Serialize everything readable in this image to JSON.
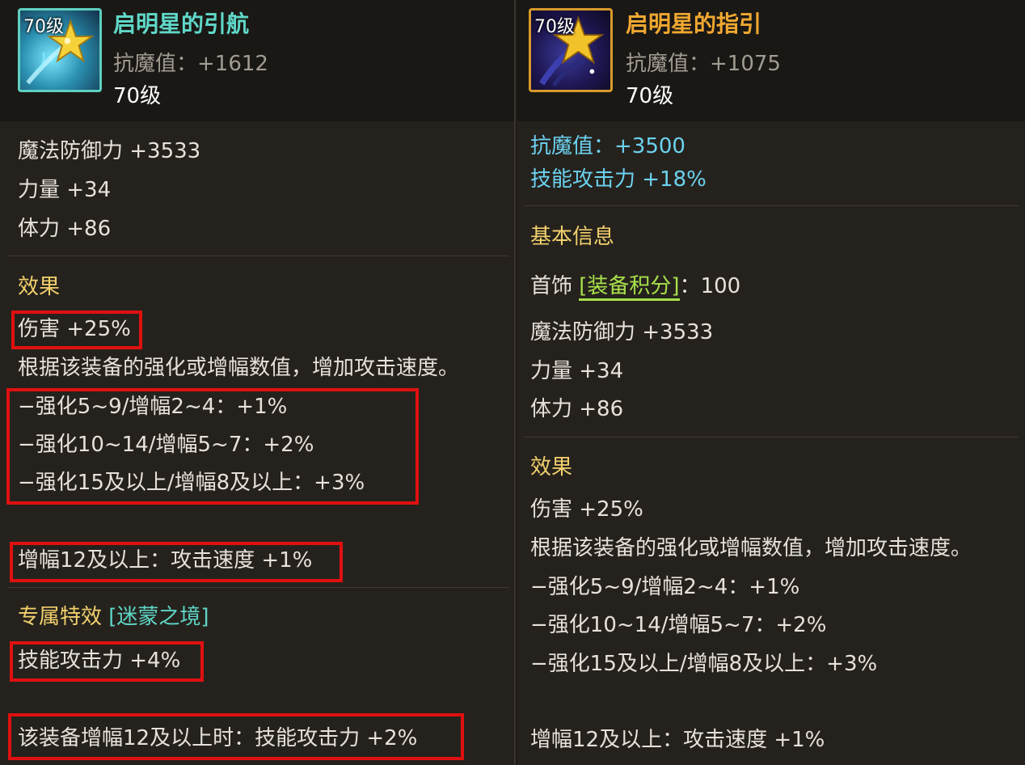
{
  "left": {
    "icon_level": "70级",
    "title": "启明星的引航",
    "resist": "抗魔值：+1612",
    "level": "70级",
    "stats": [
      "魔法防御力 +3533",
      "力量 +34",
      "体力 +86"
    ],
    "effect_header": "效果",
    "damage": "伤害 +25%",
    "desc": "根据该装备的强化或增幅数值，增加攻击速度。",
    "tiers": [
      "−强化5~9/增幅2~4：+1%",
      "−强化10~14/增幅5~7：+2%",
      "−强化15及以上/增幅8及以上：+3%"
    ],
    "amp12": "增幅12及以上：攻击速度 +1%",
    "exclusive_label": "专属特效",
    "exclusive_name": "[迷蒙之境]",
    "skill_atk": "技能攻击力 +4%",
    "amp12_skill": "该装备增幅12及以上时：技能攻击力 +2%"
  },
  "right": {
    "icon_level": "70级",
    "title": "启明星的指引",
    "resist": "抗魔值：+1075",
    "level": "70级",
    "resist_bonus": "抗魔值：+3500",
    "skill_atk": "技能攻击力 +18%",
    "basic_header": "基本信息",
    "slot_label": "首饰",
    "score_label": "[装备积分]",
    "score_value": "：100",
    "stats": [
      "魔法防御力 +3533",
      "力量 +34",
      "体力 +86"
    ],
    "effect_header": "效果",
    "damage": "伤害 +25%",
    "desc": "根据该装备的强化或增幅数值，增加攻击速度。",
    "tiers": [
      "−强化5~9/增幅2~4：+1%",
      "−强化10~14/增幅5~7：+2%",
      "−强化15及以上/增幅8及以上：+3%"
    ],
    "amp12": "增幅12及以上：攻击速度 +1%"
  },
  "colors": {
    "left_title": "#5fd8c8",
    "right_title": "#f0a830",
    "section_header": "#f2d06c",
    "bonus": "#6cd2f0",
    "highlight_box": "#e01010",
    "score_badge": "#a8e04a"
  },
  "icons": {
    "left": "star-wand-icon-blue",
    "right": "star-wand-icon-gold"
  }
}
